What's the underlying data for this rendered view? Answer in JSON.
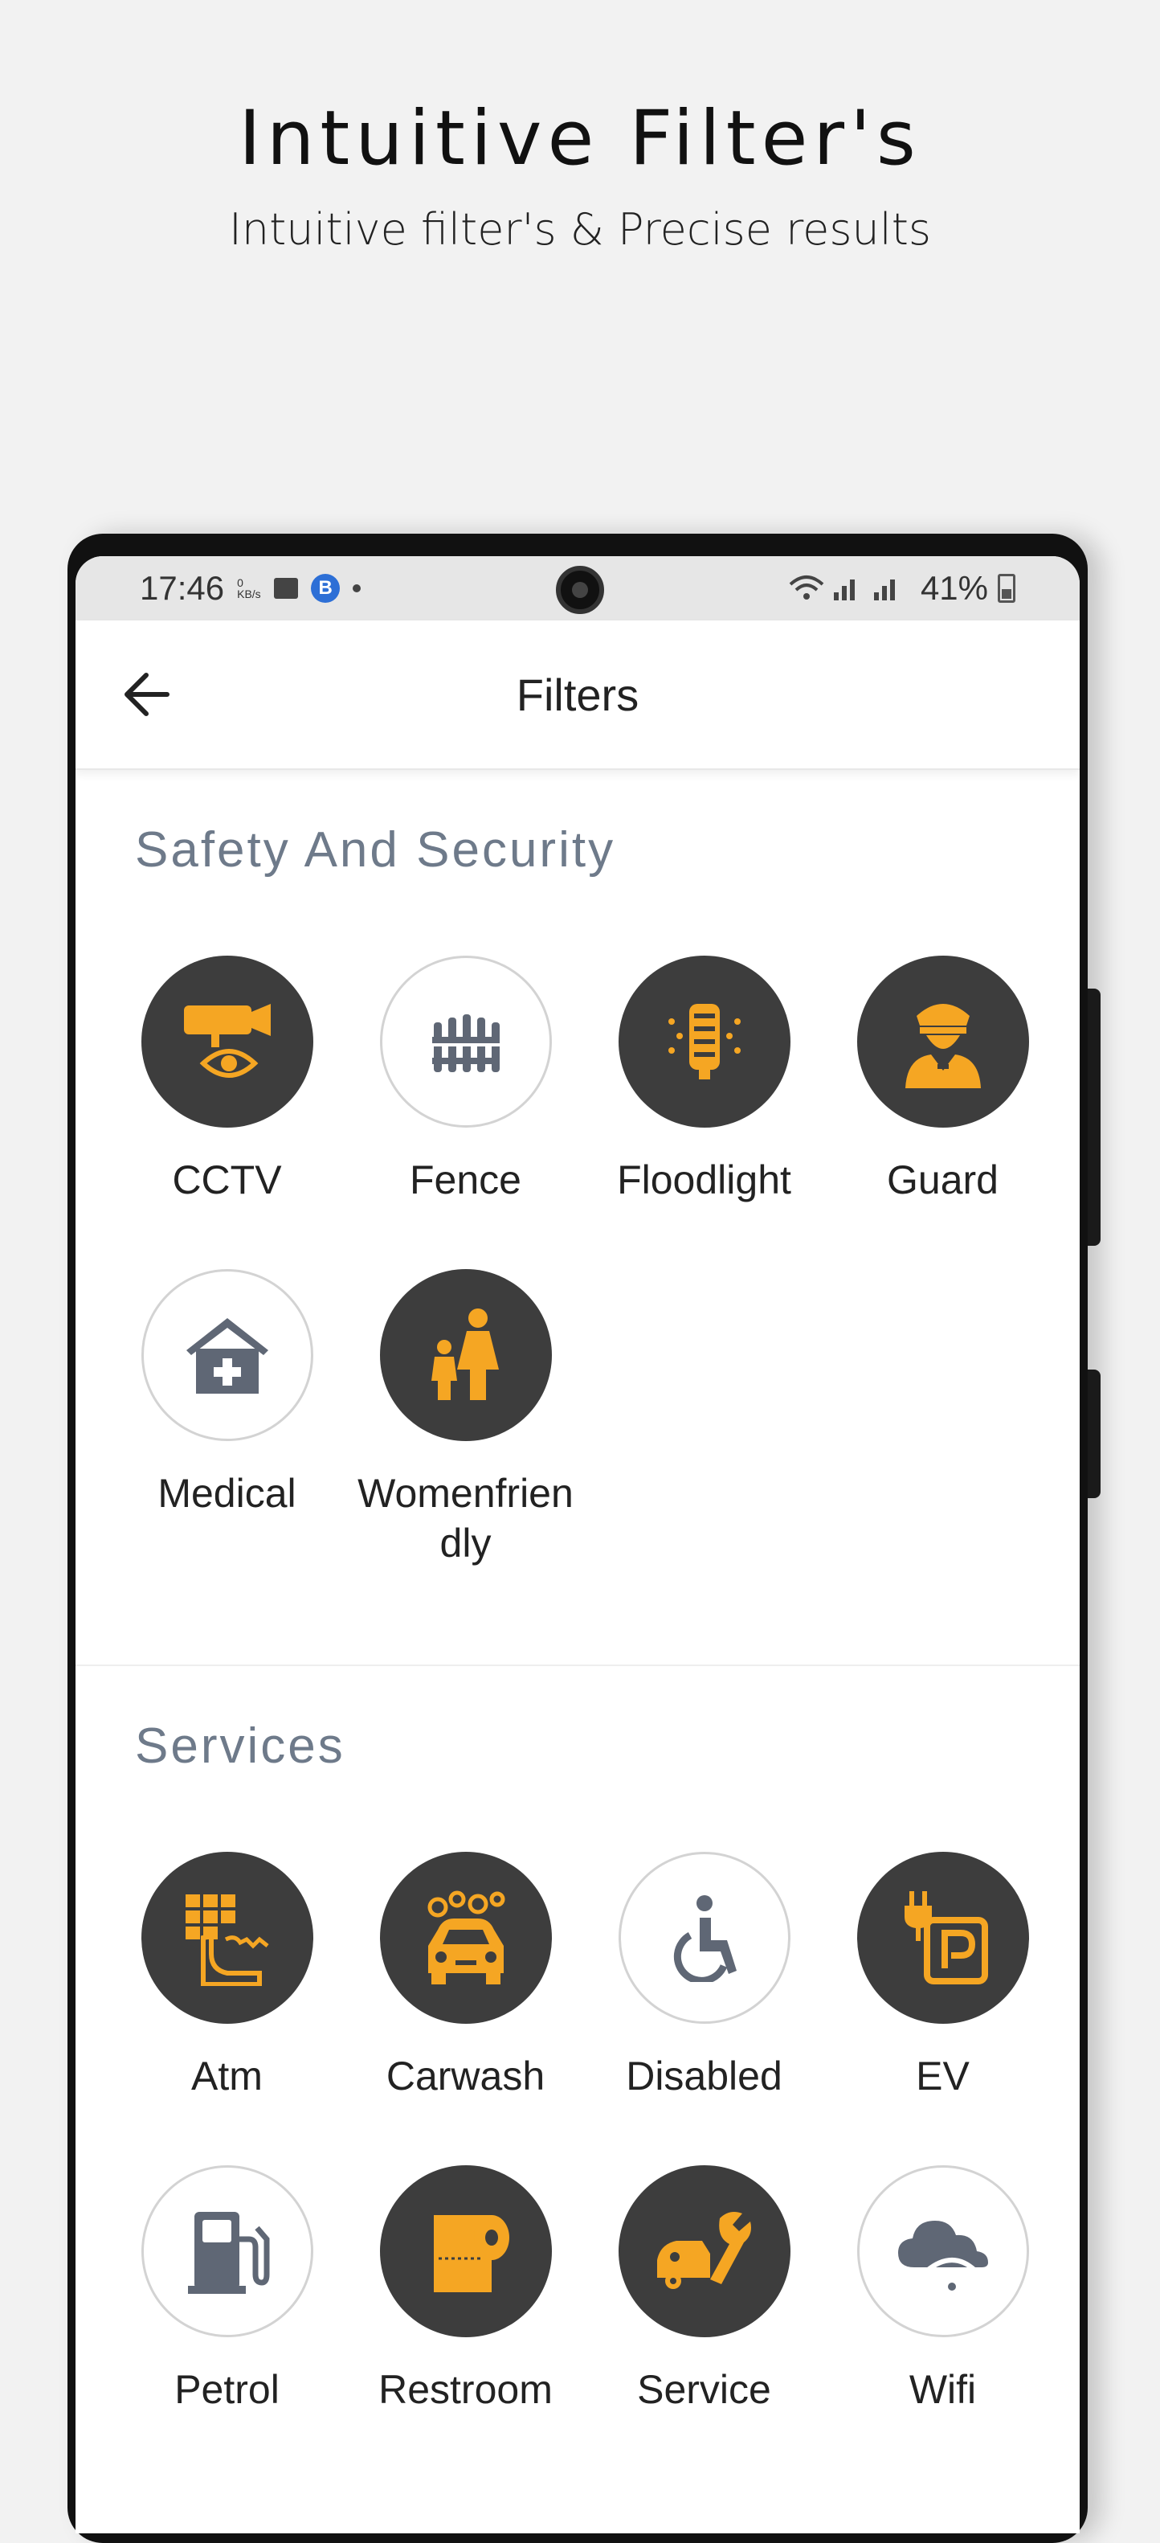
{
  "promo": {
    "title": "Intuitive Filter's",
    "subtitle": "Intuitive filter's & Precise results"
  },
  "status_bar": {
    "time": "17:46",
    "net_speed": "0 KB/s",
    "battery": "41%"
  },
  "app_bar": {
    "title": "Filters",
    "back_icon": "arrow-left-icon"
  },
  "sections": [
    {
      "title": "Safety And Security",
      "items": [
        {
          "label": "CCTV",
          "icon": "cctv-camera-icon",
          "selected": true
        },
        {
          "label": "Fence",
          "icon": "fence-icon",
          "selected": false
        },
        {
          "label": "Floodlight",
          "icon": "floodlight-icon",
          "selected": true
        },
        {
          "label": "Guard",
          "icon": "guard-icon",
          "selected": true
        },
        {
          "label": "Medical",
          "icon": "medical-house-icon",
          "selected": false
        },
        {
          "label": "Womenfriendly",
          "icon": "woman-child-icon",
          "selected": true
        }
      ]
    },
    {
      "title": "Services",
      "items": [
        {
          "label": "Atm",
          "icon": "atm-keypad-icon",
          "selected": true
        },
        {
          "label": "Carwash",
          "icon": "carwash-icon",
          "selected": true
        },
        {
          "label": "Disabled",
          "icon": "wheelchair-icon",
          "selected": false
        },
        {
          "label": "EV",
          "icon": "ev-parking-icon",
          "selected": true
        },
        {
          "label": "Petrol",
          "icon": "fuel-pump-icon",
          "selected": false
        },
        {
          "label": "Restroom",
          "icon": "toilet-roll-icon",
          "selected": true
        },
        {
          "label": "Service",
          "icon": "car-repair-icon",
          "selected": true
        },
        {
          "label": "Wifi",
          "icon": "cloud-wifi-icon",
          "selected": false
        }
      ]
    }
  ],
  "colors": {
    "accent": "#f5a623",
    "dark_circle": "#3d3d3d",
    "muted_icon": "#5f6775",
    "section_title": "#6e7a8a"
  }
}
